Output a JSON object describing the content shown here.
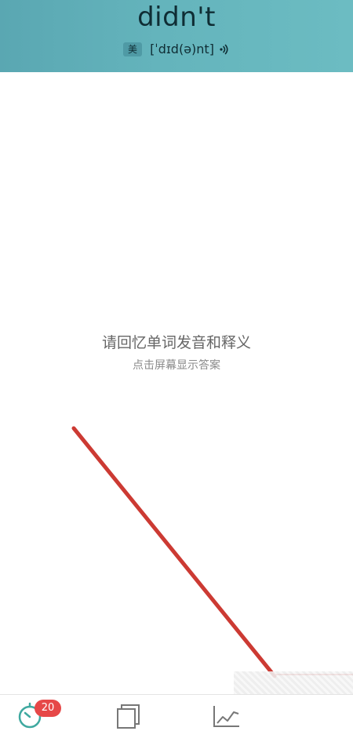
{
  "header": {
    "word": "didn't",
    "accent_label": "美",
    "phonetic": "[ˈdɪd(ə)nt]",
    "speaker_icon": "speaker-icon"
  },
  "prompt": {
    "title": "请回忆单词发音和释义",
    "subtitle": "点击屏幕显示答案"
  },
  "tabbar": {
    "tabs": [
      {
        "icon": "timer-icon",
        "badge": "20"
      },
      {
        "icon": "cards-icon"
      },
      {
        "icon": "chart-icon"
      }
    ]
  },
  "colors": {
    "header_start": "#5aa7b2",
    "header_end": "#6cbcc2",
    "badge": "#e64848",
    "accent_teal": "#3fa9a0",
    "annotation": "#cc3a33"
  }
}
